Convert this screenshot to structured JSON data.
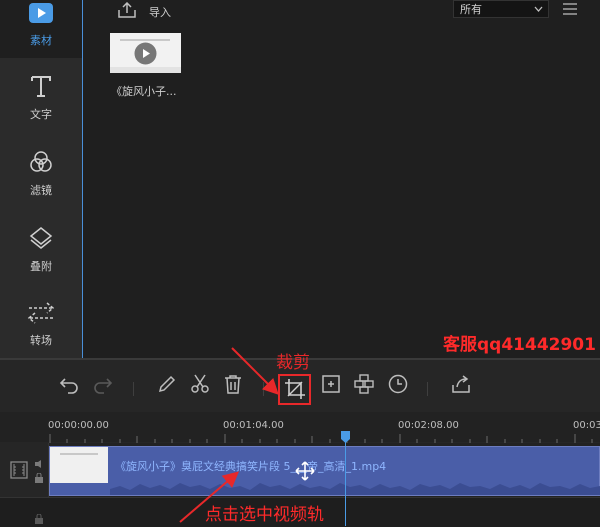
{
  "sidebar": {
    "items": [
      {
        "label": "素材",
        "icon": "play-icon",
        "active": true
      },
      {
        "label": "文字",
        "icon": "text-icon",
        "active": false
      },
      {
        "label": "滤镜",
        "icon": "filter-icon",
        "active": false
      },
      {
        "label": "叠附",
        "icon": "overlay-icon",
        "active": false
      },
      {
        "label": "转场",
        "icon": "transition-icon",
        "active": false
      }
    ]
  },
  "media": {
    "import_label": "导入",
    "filter_value": "所有",
    "thumb_title": "《旋风小子..."
  },
  "annotations": {
    "service": "客服qq41442901",
    "crop_label": "裁剪",
    "click_hint": "点击选中视频轨"
  },
  "timeline": {
    "marks": [
      "00:00:00.00",
      "00:01:04.00",
      "00:02:08.00",
      "00:03"
    ],
    "clip_name": "《旋风小子》臭屁文经典搞笑片段 5___帝_高清_1.mp4"
  },
  "colors": {
    "accent": "#4a9be6",
    "annotation_red": "#e8282a",
    "clip_blue": "#4a5ea8"
  }
}
